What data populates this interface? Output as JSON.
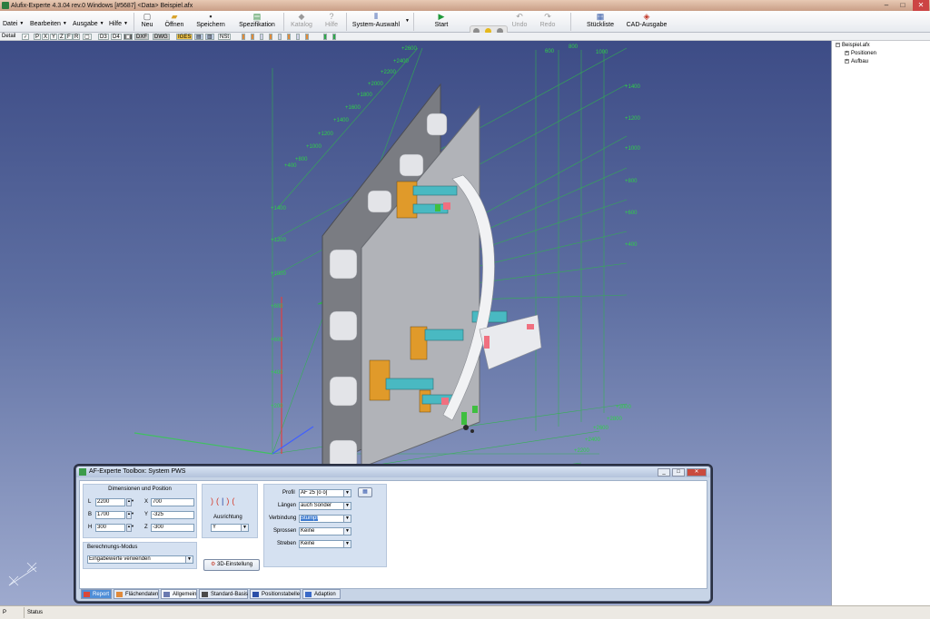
{
  "window": {
    "title": "Alufix-Experte 4.3.04 rev.0 Windows [#5687] <Data> Beispiel.afx"
  },
  "menu": [
    {
      "label": "Datei"
    },
    {
      "label": "Bearbeiten"
    },
    {
      "label": "Ausgabe"
    },
    {
      "label": "Hilfe"
    }
  ],
  "toolbar": {
    "neu": "Neu",
    "oeffnen": "Öffnen",
    "speichern": "Speichern",
    "spezifikation": "Spezifikation",
    "katalog": "Katalog",
    "hilfe": "Hilfe",
    "system_auswahl": "System-Auswahl",
    "start": "Start",
    "undo": "Undo",
    "redo": "Redo",
    "stueckliste": "Stückliste",
    "cad_ausgabe": "CAD-Ausgabe"
  },
  "toolbar2": {
    "detail": "Detail",
    "items": [
      "P",
      "X",
      "Y",
      "Z",
      "F",
      "R",
      "DXF",
      "DWG",
      "IGES",
      "NSt"
    ]
  },
  "viewport": {
    "axis_labels": {
      "left_axis": [
        "+2600",
        "+2400",
        "+2200",
        "+2000",
        "+1800",
        "+1600",
        "+1400",
        "+1200",
        "+1000",
        "+800",
        "+400"
      ],
      "right_top": [
        "1000",
        "800",
        "600"
      ],
      "right_side": [
        "+1400",
        "+1200",
        "+1000",
        "+800",
        "+600",
        "+400"
      ],
      "lower_right": [
        "+3000",
        "+2800",
        "+2600",
        "+2400",
        "+2200"
      ],
      "vertical_left": [
        "+1400",
        "+1200",
        "+1000",
        "+800",
        "+600",
        "+400",
        "+200"
      ]
    }
  },
  "tree": {
    "root": "Beispiel.afx",
    "children": [
      "Positionen",
      "Aufbau"
    ]
  },
  "status": {
    "p": "P",
    "text": "Status"
  },
  "dialog": {
    "title": "AF-Experte Toolbox: System PWS",
    "dim_group": {
      "header": "Dimensionen und Position",
      "l_label": "L",
      "l_value": "2200",
      "b_label": "B",
      "b_value": "1700",
      "h_label": "H",
      "h_value": "300",
      "x_label": "X",
      "x_value": "700",
      "y_label": "Y",
      "y_value": "-325",
      "z_label": "Z",
      "z_value": "-300"
    },
    "ausrichtung": {
      "label": "Ausrichtung",
      "value": "Y"
    },
    "berechnung": {
      "header": "Berechnungs-Modus",
      "value": "Eingabewerte verwenden"
    },
    "einstellung_button": "3D-Einstellung",
    "profile_group": {
      "profil_label": "Profil",
      "profil_value": "AF 25 [o o]",
      "laengen_label": "Längen",
      "laengen_value": "auch Sonder",
      "verbindung_label": "Verbindung",
      "verbindung_value": "Stumpf",
      "sprossen_label": "Sprossen",
      "sprossen_value": "Keine",
      "streben_label": "Streben",
      "streben_value": "Keine"
    },
    "tabs": [
      "Report",
      "Flächendaten",
      "Allgemein",
      "Standard-Basis",
      "Positionstabelle",
      "Adaption"
    ]
  },
  "colors": {
    "viewport_top": "#3d4c86",
    "viewport_bottom": "#9eaace",
    "grid_green": "#2fb64a",
    "active_tab": "#4f8ed8"
  }
}
